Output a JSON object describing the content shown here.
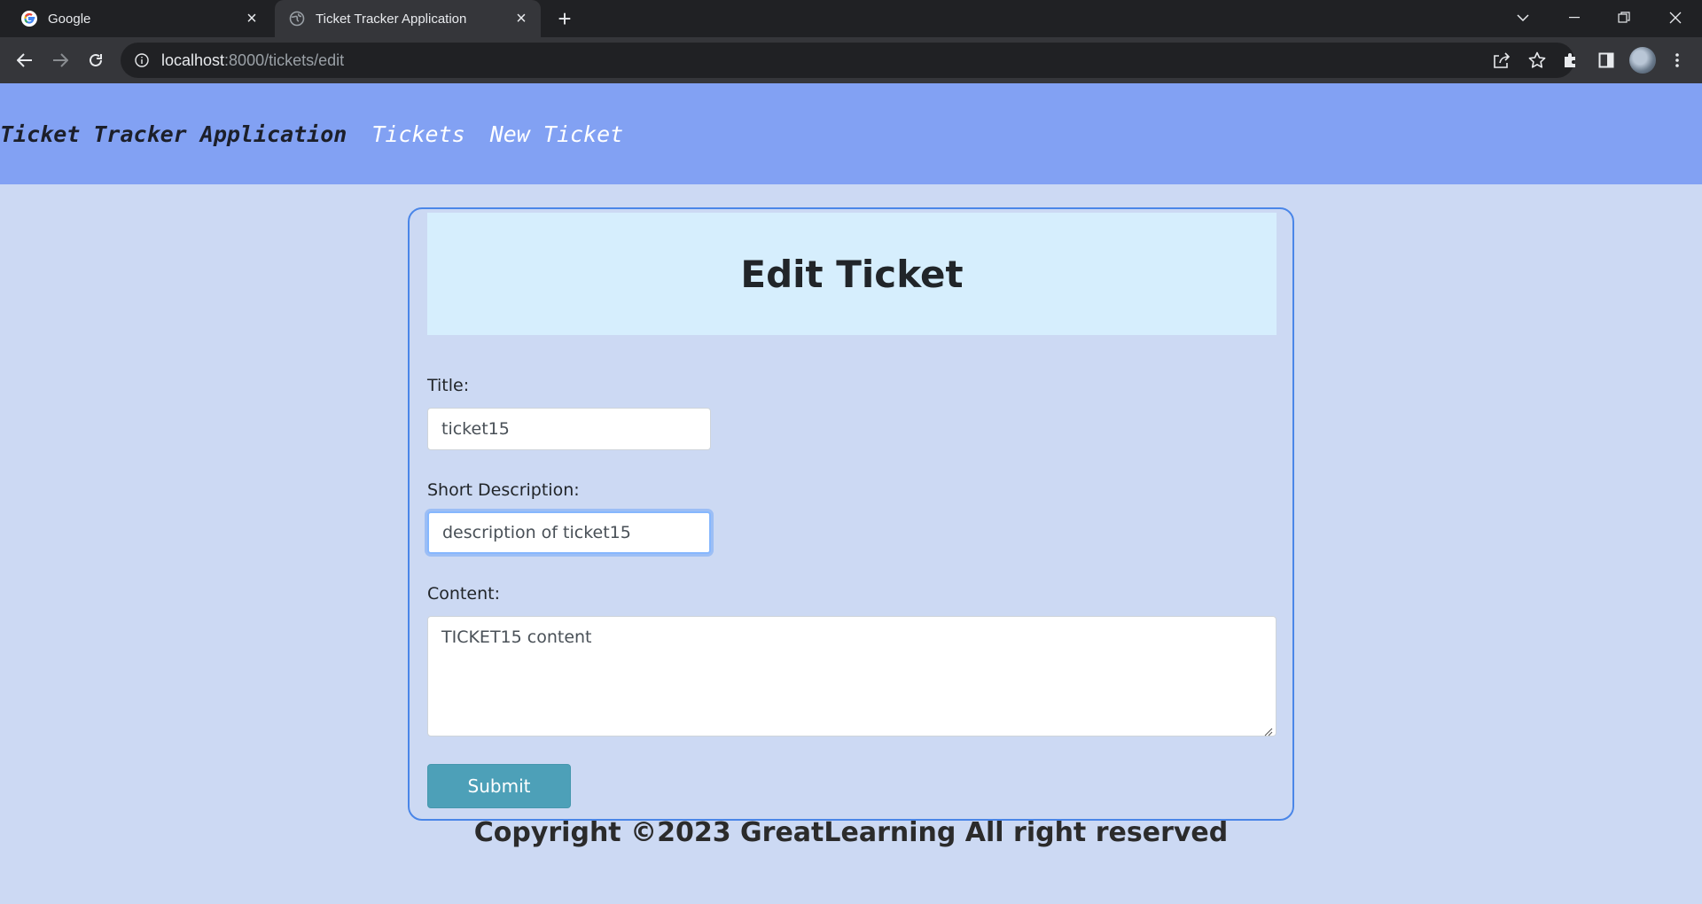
{
  "browser": {
    "tabs": [
      {
        "title": "Google",
        "favicon": "google-icon"
      },
      {
        "title": "Ticket Tracker Application",
        "favicon": "globe-icon"
      }
    ],
    "url_host": "localhost",
    "url_path": ":8000/tickets/edit"
  },
  "nav": {
    "brand": "Ticket Tracker Application",
    "links": [
      "Tickets",
      "New Ticket"
    ]
  },
  "form": {
    "heading": "Edit Ticket",
    "title_label": "Title:",
    "title_value": "ticket15",
    "description_label": "Short Description:",
    "description_value": "description of ticket15",
    "content_label": "Content:",
    "content_value": "TICKET15 content",
    "submit_label": "Submit"
  },
  "footer": {
    "text": "Copyright ©2023 GreatLearning All right reserved"
  },
  "colors": {
    "navbar": "#82a1f3",
    "page_bg": "#ccd9f3",
    "card_header": "#d6eefd",
    "submit": "#4da0b8",
    "card_border": "#4a86e8"
  }
}
